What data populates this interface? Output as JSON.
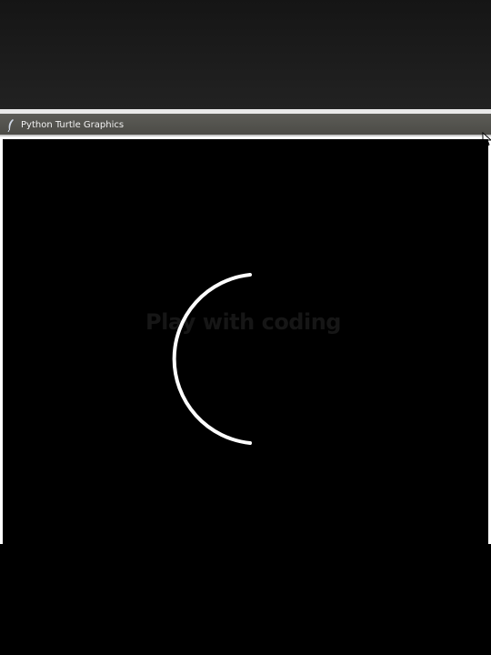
{
  "window": {
    "title": "Python Turtle Graphics",
    "icon": "feather-icon"
  },
  "canvas": {
    "background": "#000000",
    "pen_color": "#ffffff",
    "watermark": "Play with coding"
  },
  "colors": {
    "titlebar": "#52514c",
    "title_text": "#f2f2f2"
  }
}
